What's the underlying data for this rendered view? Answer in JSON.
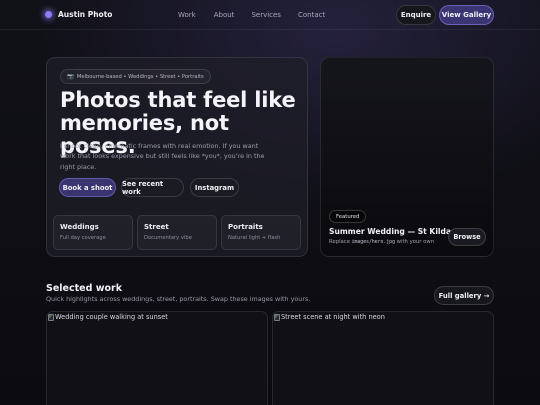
{
  "brand": {
    "name": "Austin Photo",
    "accent": "#8b7cf6"
  },
  "nav": {
    "links": [
      "Work",
      "About",
      "Services",
      "Contact"
    ],
    "enquire_label": "Enquire",
    "gallery_label": "View Gallery"
  },
  "hero": {
    "pill_icon": "camera-icon",
    "pill_glyph": "📷",
    "pill_text": "Melbourne-based • Weddings • Street • Portraits",
    "title": "Photos that feel like memories, not poses.",
    "description": "I shoot clean, cinematic frames with real emotion. If you want work that looks expensive but still feels like *you*, you’re in the right place.",
    "buttons": [
      "Book a shoot",
      "See recent work",
      "Instagram"
    ],
    "tiles": [
      {
        "title": "Weddings",
        "subtitle": "Full day coverage"
      },
      {
        "title": "Street",
        "subtitle": "Documentary vibe"
      },
      {
        "title": "Portraits",
        "subtitle": "Natural light + flash"
      }
    ]
  },
  "featured": {
    "badge": "Featured",
    "title": "Summer Wedding — St Kilda",
    "caption_prefix": "Replace ",
    "caption_code": "images/hero.jpg",
    "caption_suffix": " with your own",
    "browse_label": "Browse"
  },
  "selected_work": {
    "title": "Selected work",
    "subtitle": "Quick highlights across weddings, street, portraits. Swap these images with yours.",
    "full_gallery_label": "Full gallery →",
    "photos": [
      {
        "alt": "Wedding couple walking at sunset"
      },
      {
        "alt": "Street scene at night with neon"
      }
    ]
  }
}
